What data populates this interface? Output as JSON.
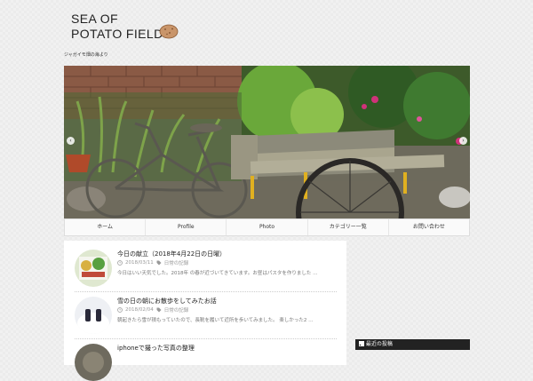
{
  "site": {
    "logo_line1": "SEA OF",
    "logo_line2": "POTATO FIELDS",
    "tagline": "ジャガイモ畑の海より"
  },
  "slider": {
    "prev": "‹",
    "next": "›"
  },
  "nav": {
    "items": [
      "ホーム",
      "Profile",
      "Photo",
      "カテゴリー一覧",
      "お問い合わせ"
    ]
  },
  "posts": [
    {
      "title": "今日の献立（2018年4月22日の日曜）",
      "date": "2018/03/11",
      "category": "日常の記録",
      "excerpt": "今日はいい天気でした。2018年 の春が近づいてきています。お昼はパスタを作りました …"
    },
    {
      "title": "雪の日の朝にお散歩をしてみたお話",
      "date": "2018/02/04",
      "category": "日常の記録",
      "excerpt": "朝起きたら雪が積もっていたので、長靴を履いて近所を歩いてみました。 楽しかった2 …"
    },
    {
      "title": "iphoneで撮った写真の整理",
      "date": "",
      "category": "",
      "excerpt": ""
    }
  ],
  "sidebar": {
    "heading": "最近の投稿"
  },
  "icons": {
    "date": "clock-icon",
    "category": "tag-icon",
    "sidebar": "rss-icon"
  }
}
